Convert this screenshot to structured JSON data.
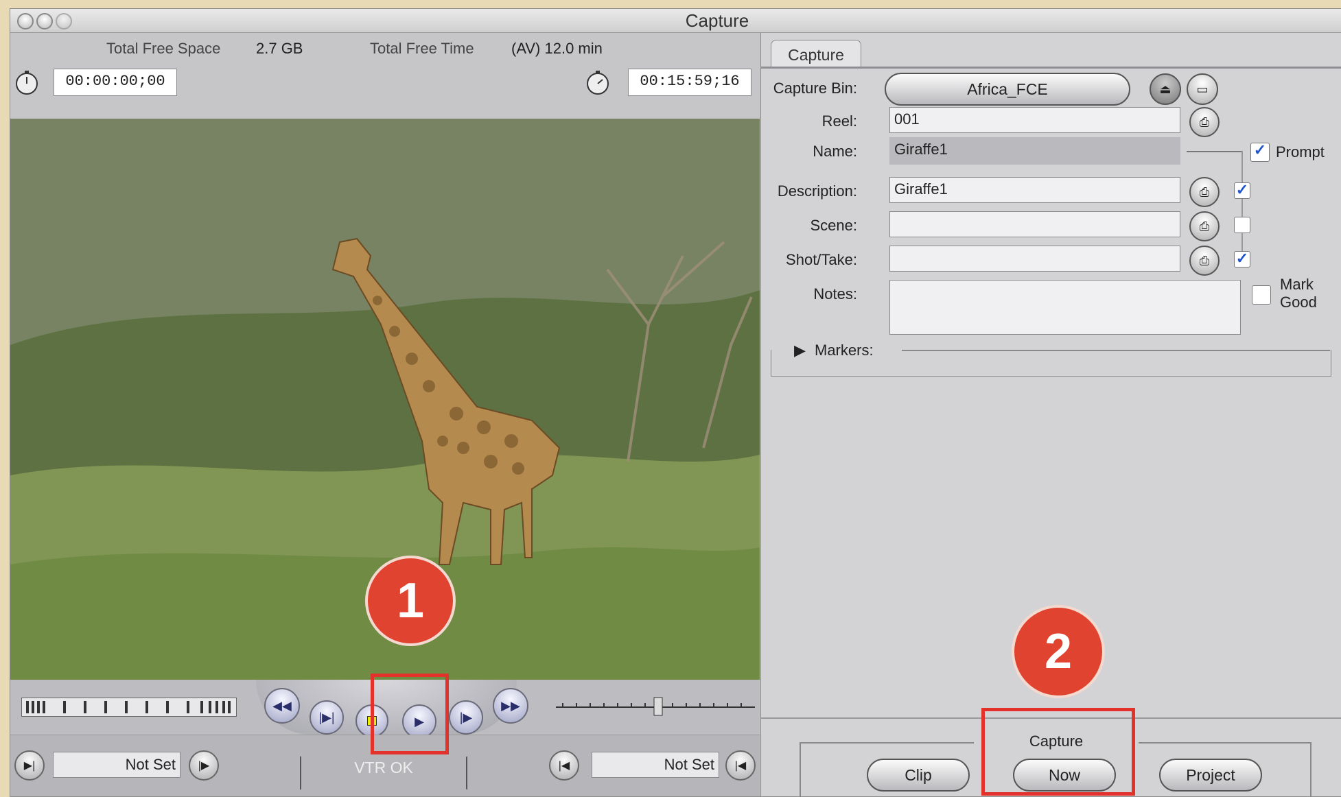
{
  "window": {
    "title": "Capture"
  },
  "top_info": {
    "free_space_label": "Total Free Space",
    "free_space_value": "2.7 GB",
    "free_time_label": "Total Free Time",
    "free_time_value": "(AV) 12.0 min",
    "timecode_in": "00:00:00;00",
    "timecode_duration": "00:15:59;16"
  },
  "transport": {
    "vtr_status": "VTR OK"
  },
  "in_out": {
    "in_value": "Not Set",
    "out_value": "Not Set"
  },
  "panel": {
    "tab": "Capture",
    "capture_bin_label": "Capture Bin:",
    "capture_bin_value": "Africa_FCE",
    "reel_label": "Reel:",
    "reel_value": "001",
    "name_label": "Name:",
    "name_value": "Giraffe1",
    "prompt_label": "Prompt",
    "description_label": "Description:",
    "description_value": "Giraffe1",
    "scene_label": "Scene:",
    "scene_value": "",
    "shot_label": "Shot/Take:",
    "shot_value": "",
    "notes_label": "Notes:",
    "mark_good_line1": "Mark",
    "mark_good_line2": "Good",
    "markers_label": "Markers:"
  },
  "capture_buttons": {
    "group_label": "Capture",
    "clip": "Clip",
    "now": "Now",
    "project": "Project"
  },
  "annotations": {
    "badge1": "1",
    "badge2": "2"
  },
  "colors": {
    "annotation_red": "#e2322b",
    "badge_fill": "#e0432f"
  }
}
